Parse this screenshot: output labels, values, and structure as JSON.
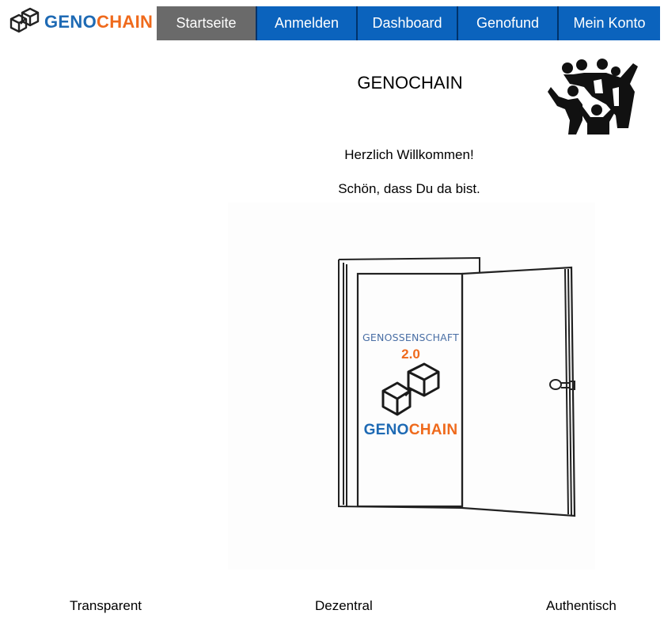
{
  "header": {
    "logo": {
      "geno": "GENO",
      "chain": "CHAIN",
      "icon": "interlocking-cubes-icon"
    },
    "nav": [
      {
        "label": "Startseite",
        "active": true
      },
      {
        "label": "Anmelden",
        "active": false
      },
      {
        "label": "Dashboard",
        "active": false
      },
      {
        "label": "Genofund",
        "active": false
      },
      {
        "label": "Mein Konto",
        "active": false
      }
    ]
  },
  "main": {
    "title": "GENOCHAIN",
    "group_icon": "community-people-icon",
    "welcome": "Herzlich Willkommen!",
    "subtitle": "Schön, dass Du da bist.",
    "door": {
      "heading": "GENOSSENSCHAFT",
      "version": "2.0",
      "brand_geno": "GENO",
      "brand_chain": "CHAIN"
    }
  },
  "footer": {
    "items": [
      "Transparent",
      "Dezentral",
      "Authentisch"
    ]
  },
  "colors": {
    "nav_blue": "#0b63bd",
    "nav_active": "#6a6a6a",
    "brand_blue": "#1e6ab4",
    "brand_orange": "#ef6a1c"
  }
}
